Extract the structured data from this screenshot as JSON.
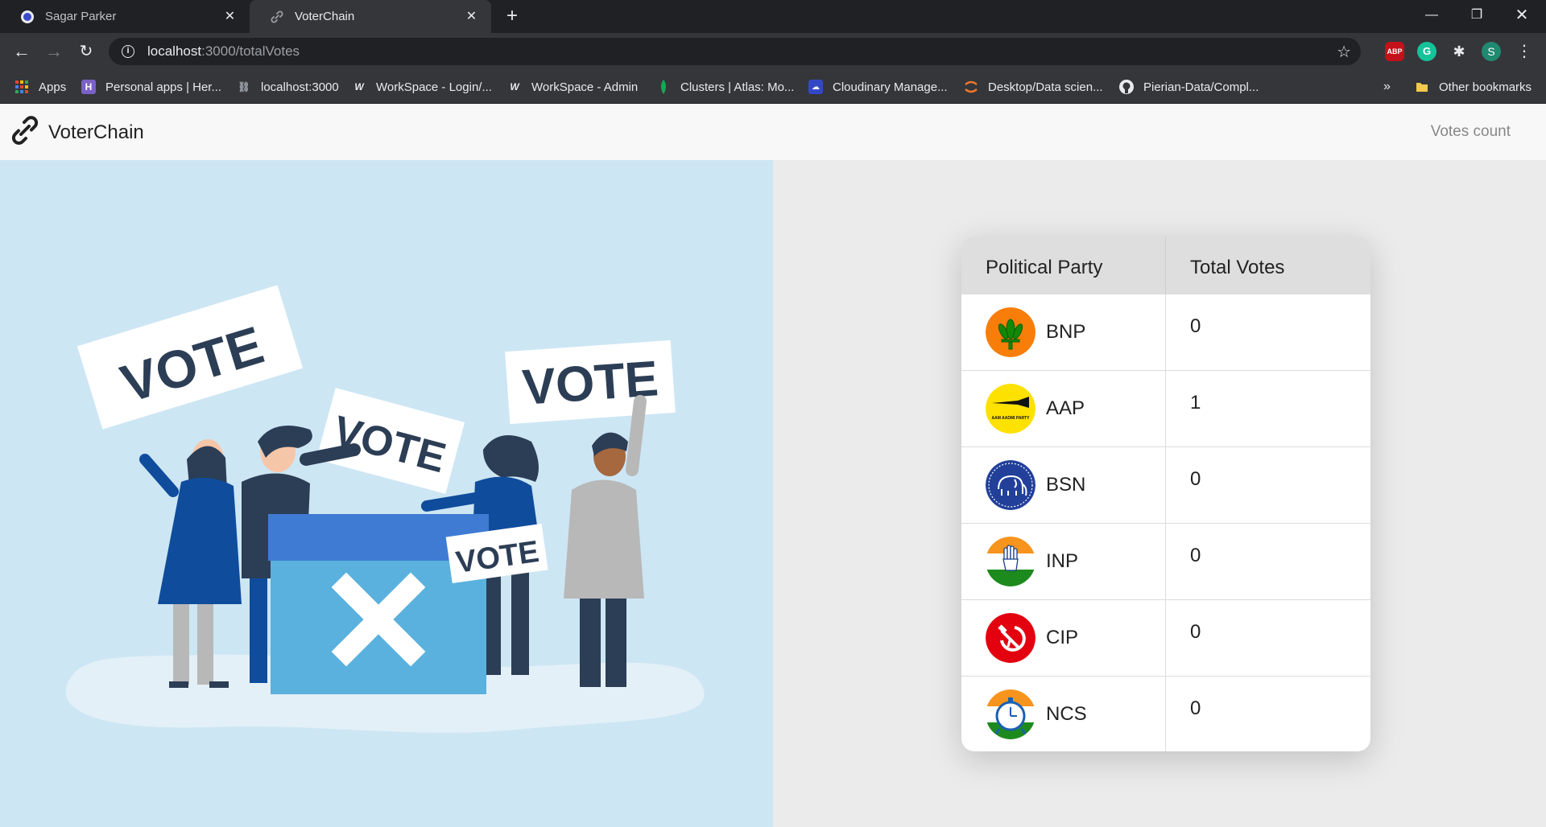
{
  "browser": {
    "tabs": [
      {
        "title": "Sagar Parker",
        "favicon": "sp-profile-icon"
      },
      {
        "title": "VoterChain",
        "favicon": "link-icon"
      }
    ],
    "url_host": "localhost",
    "url_path": ":3000/totalVotes",
    "extensions": [
      "ABP",
      "G",
      "S"
    ],
    "bookmarks": [
      {
        "label": "Apps",
        "icon": "apps-grid-icon"
      },
      {
        "label": "Personal apps | Her...",
        "icon": "heroku-icon"
      },
      {
        "label": "localhost:3000",
        "icon": "link-icon"
      },
      {
        "label": "WorkSpace - Login/...",
        "icon": "workspace-icon"
      },
      {
        "label": "WorkSpace - Admin",
        "icon": "workspace-icon"
      },
      {
        "label": "Clusters | Atlas: Mo...",
        "icon": "mongodb-leaf-icon"
      },
      {
        "label": "Cloudinary Manage...",
        "icon": "cloudinary-icon"
      },
      {
        "label": "Desktop/Data scien...",
        "icon": "jupyter-icon"
      },
      {
        "label": "Pierian-Data/Compl...",
        "icon": "github-icon"
      }
    ],
    "bookmarks_overflow": "»",
    "other_bookmarks": "Other bookmarks"
  },
  "app": {
    "brand": "VoterChain",
    "nav_link": "Votes count"
  },
  "illustration": {
    "signs": [
      "VOTE",
      "VOTE",
      "VOTE",
      "VOTE"
    ]
  },
  "table": {
    "headers": [
      "Political Party",
      "Total Votes"
    ],
    "rows": [
      {
        "party": "BNP",
        "votes": "0",
        "logo": "lotus-logo-icon"
      },
      {
        "party": "AAP",
        "votes": "1",
        "logo": "broom-logo-icon",
        "logo_text": "AAM AADMI PARTY"
      },
      {
        "party": "BSN",
        "votes": "0",
        "logo": "elephant-logo-icon"
      },
      {
        "party": "INP",
        "votes": "0",
        "logo": "hand-logo-icon"
      },
      {
        "party": "CIP",
        "votes": "0",
        "logo": "hammer-sickle-logo-icon"
      },
      {
        "party": "NCS",
        "votes": "0",
        "logo": "clock-logo-icon"
      }
    ]
  },
  "colors": {
    "illustration_bg": "#cde6f4",
    "ballot_box_top": "#3f7bd3",
    "ballot_box_front": "#5bb1dd",
    "sign_text": "#2c3e55"
  }
}
